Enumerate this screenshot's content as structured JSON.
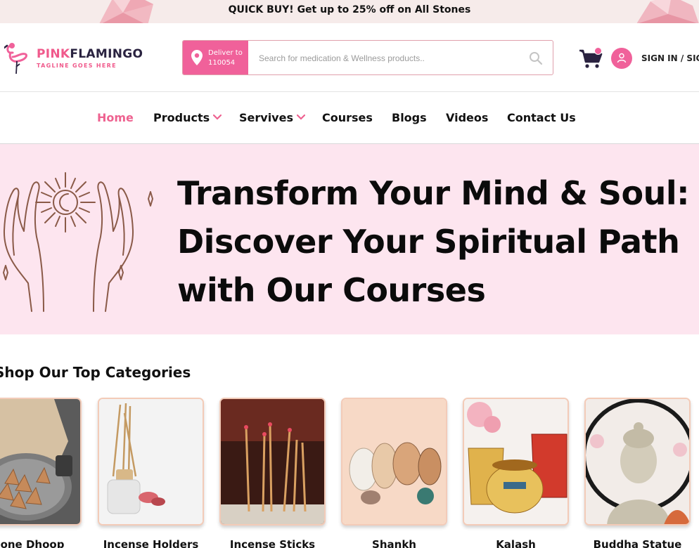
{
  "promo": {
    "text": "QUICK BUY! Get up to 25% off on All Stones"
  },
  "brand": {
    "name_part1": "PINK",
    "name_part2": "FLAMINGO",
    "tagline": "TAGLINE GOES HERE",
    "accent": "#f0619a",
    "logo_icon": "flamingo-icon"
  },
  "search": {
    "deliver_label_line1": "Deliver to",
    "deliver_label_line2": "110054",
    "placeholder": "Search for medication & Wellness products..",
    "icon": "search-icon"
  },
  "header": {
    "cart_icon": "cart-icon",
    "user_icon": "user-icon",
    "signin_label": "SIGN IN / SIGN UP"
  },
  "nav": {
    "items": [
      {
        "label": "Home",
        "active": true
      },
      {
        "label": "Products",
        "dropdown": true
      },
      {
        "label": "Servives",
        "dropdown": true
      },
      {
        "label": "Courses"
      },
      {
        "label": "Blogs"
      },
      {
        "label": "Videos"
      },
      {
        "label": "Contact Us"
      }
    ]
  },
  "hero": {
    "line1": "Transform Your Mind & Soul:",
    "line2": "Discover Your Spiritual Path",
    "line3": "with Our Courses",
    "background": "#fde5ef",
    "illustration": "hands-moon-icon"
  },
  "categories": {
    "heading": "Shop Our Top Categories",
    "items": [
      {
        "label": "Cone Dhoop"
      },
      {
        "label": "Incense Holders"
      },
      {
        "label": "Incense Sticks"
      },
      {
        "label": "Shankh"
      },
      {
        "label": "Kalash"
      },
      {
        "label": "Buddha Statue"
      }
    ]
  }
}
